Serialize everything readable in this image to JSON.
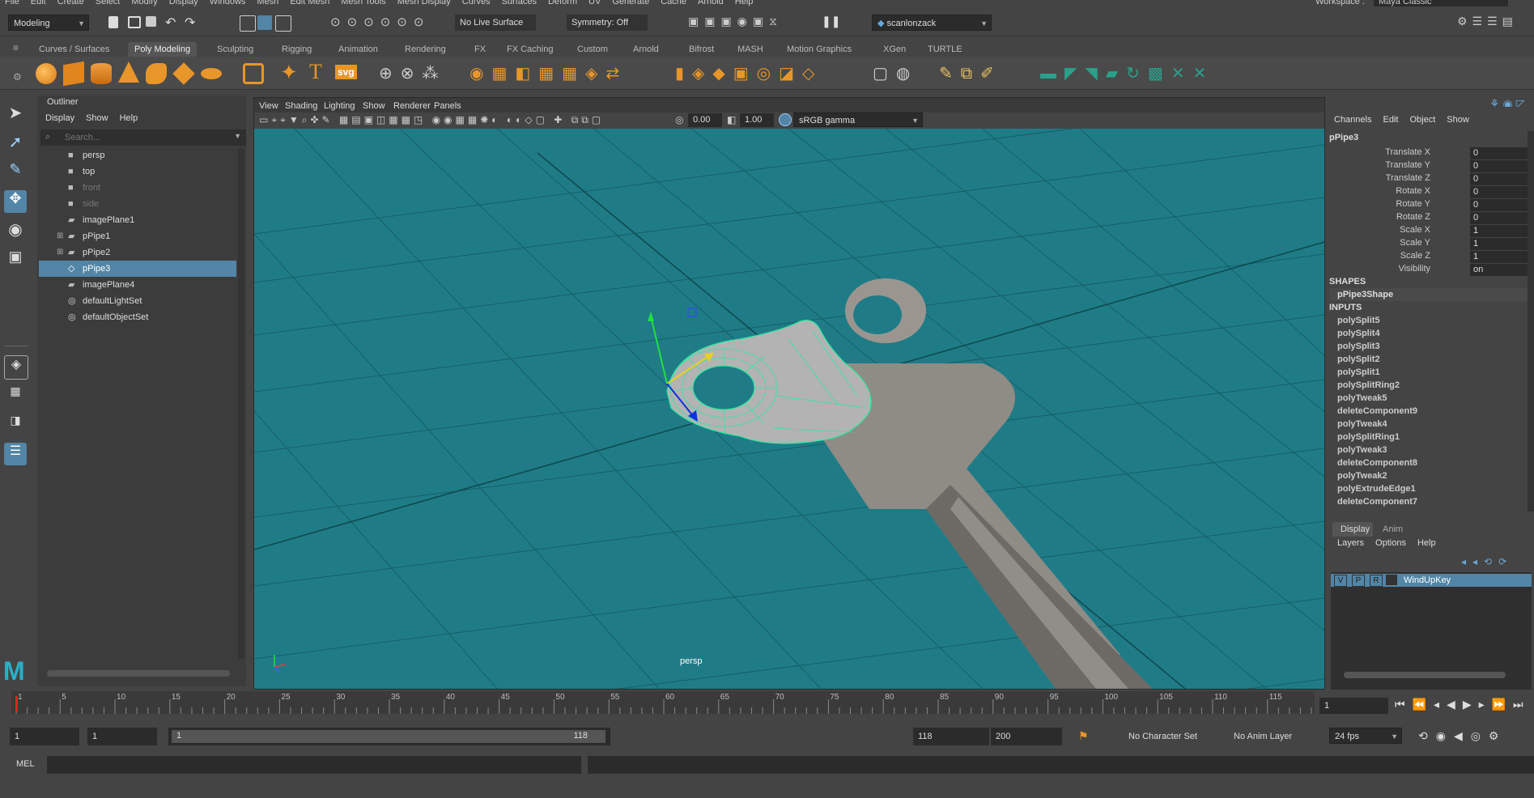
{
  "menubar": [
    "File",
    "Edit",
    "Create",
    "Select",
    "Modify",
    "Display",
    "Windows",
    "Mesh",
    "Edit Mesh",
    "Mesh Tools",
    "Mesh Display",
    "Curves",
    "Surfaces",
    "Deform",
    "UV",
    "Generate",
    "Cache",
    "Arnold",
    "Help"
  ],
  "workspace": {
    "label": "Workspace :",
    "value": "Maya Classic"
  },
  "statusline": {
    "mode": "Modeling",
    "live_surface": "No Live Surface",
    "symmetry": "Symmetry: Off",
    "user": "scanlonzack"
  },
  "shelf_tabs": [
    "Curves / Surfaces",
    "Poly Modeling",
    "Sculpting",
    "Rigging",
    "Animation",
    "Rendering",
    "FX",
    "FX Caching",
    "Custom",
    "Arnold",
    "Bifrost",
    "MASH",
    "Motion Graphics",
    "XGen",
    "TURTLE"
  ],
  "shelf_active": "Poly Modeling",
  "shelf_svg_label": "svg",
  "shelf_text_label": "T",
  "outliner": {
    "title": "Outliner",
    "menus": [
      "Display",
      "Show",
      "Help"
    ],
    "search_placeholder": "Search...",
    "items": [
      {
        "label": "persp",
        "type": "camera",
        "dim": false,
        "sel": false,
        "expand": false
      },
      {
        "label": "top",
        "type": "camera",
        "dim": false,
        "sel": false,
        "expand": false
      },
      {
        "label": "front",
        "type": "camera",
        "dim": true,
        "sel": false,
        "expand": false
      },
      {
        "label": "side",
        "type": "camera",
        "dim": true,
        "sel": false,
        "expand": false
      },
      {
        "label": "imagePlane1",
        "type": "image",
        "dim": false,
        "sel": false,
        "expand": false
      },
      {
        "label": "pPipe1",
        "type": "mesh",
        "dim": false,
        "sel": false,
        "expand": true
      },
      {
        "label": "pPipe2",
        "type": "mesh",
        "dim": false,
        "sel": false,
        "expand": true
      },
      {
        "label": "pPipe3",
        "type": "mesh",
        "dim": false,
        "sel": true,
        "expand": false
      },
      {
        "label": "imagePlane4",
        "type": "image",
        "dim": false,
        "sel": false,
        "expand": false
      },
      {
        "label": "defaultLightSet",
        "type": "set",
        "dim": false,
        "sel": false,
        "expand": false
      },
      {
        "label": "defaultObjectSet",
        "type": "set",
        "dim": false,
        "sel": false,
        "expand": false
      }
    ]
  },
  "viewport": {
    "menus": [
      "View",
      "Shading",
      "Lighting",
      "Show",
      "Renderer",
      "Panels"
    ],
    "exposure": "0.00",
    "gamma": "1.00",
    "color_space": "sRGB gamma",
    "camera_label": "persp"
  },
  "channelbox": {
    "menus": [
      "Channels",
      "Edit",
      "Object",
      "Show"
    ],
    "object": "pPipe3",
    "attributes": [
      {
        "name": "Translate X",
        "value": "0"
      },
      {
        "name": "Translate Y",
        "value": "0"
      },
      {
        "name": "Translate Z",
        "value": "0"
      },
      {
        "name": "Rotate X",
        "value": "0"
      },
      {
        "name": "Rotate Y",
        "value": "0"
      },
      {
        "name": "Rotate Z",
        "value": "0"
      },
      {
        "name": "Scale X",
        "value": "1"
      },
      {
        "name": "Scale Y",
        "value": "1"
      },
      {
        "name": "Scale Z",
        "value": "1"
      },
      {
        "name": "Visibility",
        "value": "on"
      }
    ],
    "shapes_header": "SHAPES",
    "shape": "pPipe3Shape",
    "inputs_header": "INPUTS",
    "inputs": [
      "polySplit5",
      "polySplit4",
      "polySplit3",
      "polySplit2",
      "polySplit1",
      "polySplitRing2",
      "polyTweak5",
      "deleteComponent9",
      "polyTweak4",
      "polySplitRing1",
      "polyTweak3",
      "deleteComponent8",
      "polyTweak2",
      "polyExtrudeEdge1",
      "deleteComponent7"
    ]
  },
  "layers": {
    "tabs": [
      "Display",
      "Anim"
    ],
    "menus": [
      "Layers",
      "Options",
      "Help"
    ],
    "flags": [
      "V",
      "P",
      "R"
    ],
    "layer_name": "WindUpKey"
  },
  "timeline": {
    "ticks": [
      "1",
      "5",
      "10",
      "15",
      "20",
      "25",
      "30",
      "35",
      "40",
      "45",
      "50",
      "55",
      "60",
      "65",
      "70",
      "75",
      "80",
      "85",
      "90",
      "95",
      "100",
      "105",
      "110",
      "115"
    ],
    "current_frame": "1"
  },
  "range": {
    "start": "1",
    "playback_start": "1",
    "slider_start": "1",
    "slider_end": "118",
    "playback_end": "118",
    "end": "200",
    "character_set": "No Character Set",
    "anim_layer": "No Anim Layer",
    "fps": "24 fps"
  },
  "cmdline": {
    "label": "MEL"
  },
  "colors": {
    "accent": "#5285a6",
    "viewport": "#1f7c87",
    "shelf_orange": "#e8962a",
    "shelf_teal": "#2aa08a"
  }
}
